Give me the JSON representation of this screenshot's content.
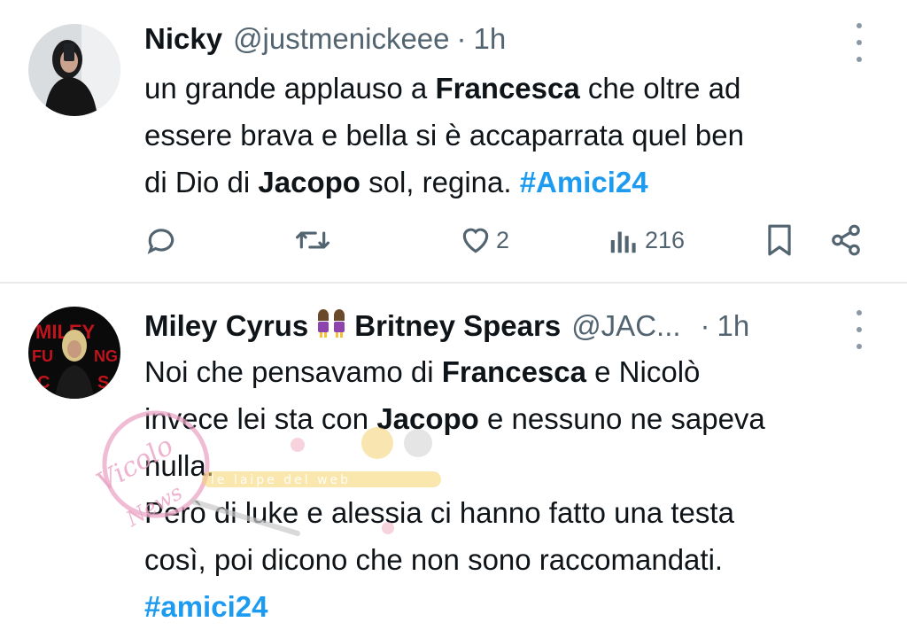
{
  "tweets": [
    {
      "name": "Nicky",
      "handle": "@justmenickeee",
      "separator": "·",
      "time": "1h",
      "text_lines": [
        [
          "un grande applauso a ",
          "Francesca",
          " che oltre ad"
        ],
        [
          "essere brava e bella si è accaparrata quel ben"
        ],
        [
          "di Dio di ",
          "Jacopo",
          " sol, regina. ",
          "#Amici24"
        ]
      ],
      "likes": "2",
      "views": "216"
    },
    {
      "name": "Miley Cyrus",
      "emoji": "👭",
      "name2": "Britney Spears",
      "handle": "@JAC...",
      "separator": "·",
      "time": "1h",
      "line1a": "Noi che pensavamo di ",
      "line1b": "Francesca",
      "line1c": " e Nicolò",
      "line2a": "invece lei sta con ",
      "line2b": "Jacopo",
      "line2c": " e nessuno ne sapeva",
      "line3": "nulla.",
      "line4": "Però di luke e alessia ci hanno fatto una testa",
      "line5": "così, poi dicono che non sono raccomandati.",
      "hashtag": "#amici24"
    }
  ],
  "avatar_text": "MILEY",
  "watermark": {
    "script_text": "Vicolo delle News",
    "tagline": "le laipe del web"
  },
  "icons": [
    "reply-icon",
    "retweet-icon",
    "like-icon",
    "views-icon",
    "bookmark-icon",
    "share-icon",
    "more-icon"
  ],
  "colors": {
    "text": "#0f1419",
    "muted": "#536471",
    "link": "#1d9bf0",
    "divider": "#e7e9ea"
  }
}
